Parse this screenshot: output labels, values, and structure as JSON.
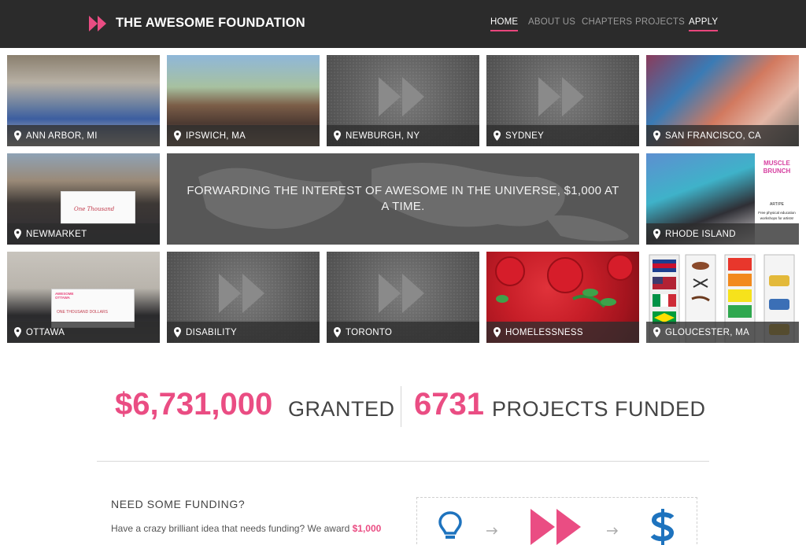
{
  "header": {
    "brand": "THE AWESOME FOUNDATION",
    "nav": [
      {
        "label": "HOME",
        "active": true
      },
      {
        "label": "ABOUT US",
        "active": false
      },
      {
        "label": "CHAPTERS",
        "active": false
      },
      {
        "label": "PROJECTS",
        "active": false
      },
      {
        "label": "APPLY",
        "active": true
      }
    ]
  },
  "tiles": {
    "ann_arbor": "ANN ARBOR, MI",
    "ipswich": "IPSWICH, MA",
    "newburgh": "NEWBURGH, NY",
    "sydney": "SYDNEY",
    "san_francisco": "SAN FRANCISCO, CA",
    "newmarket": "NEWMARKET",
    "rhode_island": "RHODE ISLAND",
    "ottawa": "OTTAWA",
    "disability": "DISABILITY",
    "toronto": "TORONTO",
    "homelessness": "HOMELESSNESS",
    "gloucester": "GLOUCESTER, MA"
  },
  "banner": {
    "tagline": "FORWARDING THE INTEREST OF AWESOME IN THE UNIVERSE, $1,000 AT A TIME."
  },
  "photo_text": {
    "muscle_brunch_logo": "MUSCLE BRUNCH",
    "muscle_brunch_line1": "ART/PE",
    "muscle_brunch_line2": "Free physical education",
    "muscle_brunch_line3": "workshops for artists!",
    "ottawa_check_brand": "AWESOME OTTAWA",
    "ottawa_check_amount": "ONE THOUSAND DOLLARS",
    "newmarket_check_amount": "One Thousand"
  },
  "stats": {
    "granted_amount": "$6,731,000",
    "granted_label": "GRANTED",
    "projects_count": "6731",
    "projects_label": "PROJECTS FUNDED"
  },
  "funding": {
    "title": "NEED SOME FUNDING?",
    "text_prefix": "Have a crazy brilliant idea that needs funding? We award ",
    "text_highlight": "$1,000"
  },
  "colors": {
    "accent": "#ea4d83",
    "header_bg": "#2b2b2b"
  },
  "icons": [
    "logo-icon",
    "location-pin-icon",
    "fast-forward-icon",
    "lightbulb-icon",
    "arrow-right-icon",
    "dollar-icon"
  ]
}
